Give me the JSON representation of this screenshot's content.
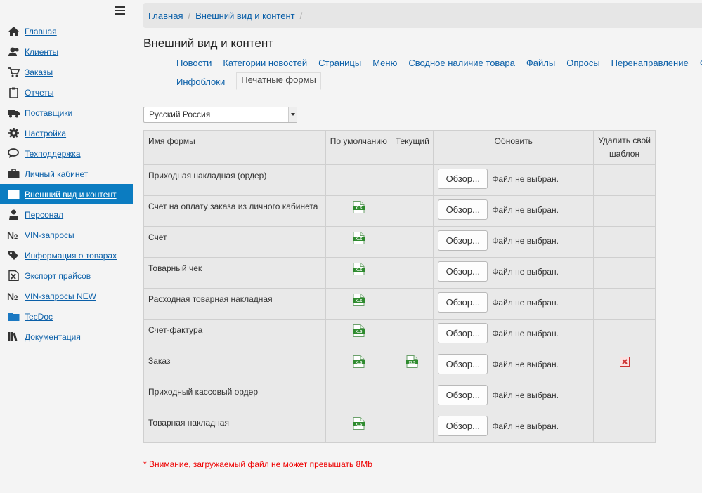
{
  "sidebar": {
    "items": [
      {
        "label": "Главная",
        "icon": "home-icon",
        "active": false
      },
      {
        "label": "Клиенты",
        "icon": "users-icon",
        "active": false
      },
      {
        "label": "Заказы",
        "icon": "cart-icon",
        "active": false
      },
      {
        "label": "Отчеты",
        "icon": "clipboard-icon",
        "active": false
      },
      {
        "label": "Поставщики",
        "icon": "truck-icon",
        "active": false
      },
      {
        "label": "Настройка",
        "icon": "gear-icon",
        "active": false
      },
      {
        "label": "Техподдержка",
        "icon": "chat-icon",
        "active": false
      },
      {
        "label": "Личный кабинет",
        "icon": "briefcase-icon",
        "active": false
      },
      {
        "label": "Внешний вид и контент",
        "icon": "image-icon",
        "active": true
      },
      {
        "label": "Персонал",
        "icon": "person-icon",
        "active": false
      },
      {
        "label": "VIN-запросы",
        "icon": "numero-icon",
        "active": false
      },
      {
        "label": "Информация о товарах",
        "icon": "tags-icon",
        "active": false
      },
      {
        "label": "Экспорт прайсов",
        "icon": "excel-icon",
        "active": false
      },
      {
        "label": "VIN-запросы NEW",
        "icon": "numero-icon",
        "active": false
      },
      {
        "label": "TecDoc",
        "icon": "folder-icon",
        "active": false
      },
      {
        "label": "Документация",
        "icon": "books-icon",
        "active": false
      }
    ]
  },
  "breadcrumb": {
    "home": "Главная",
    "current": "Внешний вид и контент",
    "sep": "/"
  },
  "page_title": "Внешний вид и контент",
  "tabs": {
    "row1": [
      "Новости",
      "Категории новостей",
      "Страницы",
      "Меню",
      "Сводное наличие товара",
      "Файлы",
      "Опросы",
      "Перенаправление",
      "Ф"
    ],
    "row2": [
      "Инфоблоки"
    ],
    "active": "Печатные формы"
  },
  "language_select": {
    "value": "Русский Россия"
  },
  "table": {
    "headers": {
      "name": "Имя формы",
      "default": "По умолчанию",
      "current": "Текущий",
      "update": "Обновить",
      "delete": "Удалить свой шаблон"
    },
    "browse_label": "Обзор...",
    "no_file_label": "Файл не выбран.",
    "rows": [
      {
        "name": "Приходная накладная (ордер)",
        "default": false,
        "current": false,
        "delete": false
      },
      {
        "name": "Счет на оплату заказа из личного кабинета",
        "default": true,
        "current": false,
        "delete": false
      },
      {
        "name": "Счет",
        "default": true,
        "current": false,
        "delete": false
      },
      {
        "name": "Товарный чек",
        "default": true,
        "current": false,
        "delete": false
      },
      {
        "name": "Расходная товарная накладная",
        "default": true,
        "current": false,
        "delete": false
      },
      {
        "name": "Счет-фактура",
        "default": true,
        "current": false,
        "delete": false
      },
      {
        "name": "Заказ",
        "default": true,
        "current": true,
        "delete": true
      },
      {
        "name": "Приходный кассовый ордер",
        "default": false,
        "current": false,
        "delete": false
      },
      {
        "name": "Товарная накладная",
        "default": true,
        "current": false,
        "delete": false
      }
    ]
  },
  "warning": "* Внимание, загружаемый файл не может превышать 8Mb",
  "colors": {
    "accent": "#0b7cc1",
    "link": "#0a5fa8",
    "warning": "#e00000",
    "xls_green": "#2e8b2e"
  }
}
